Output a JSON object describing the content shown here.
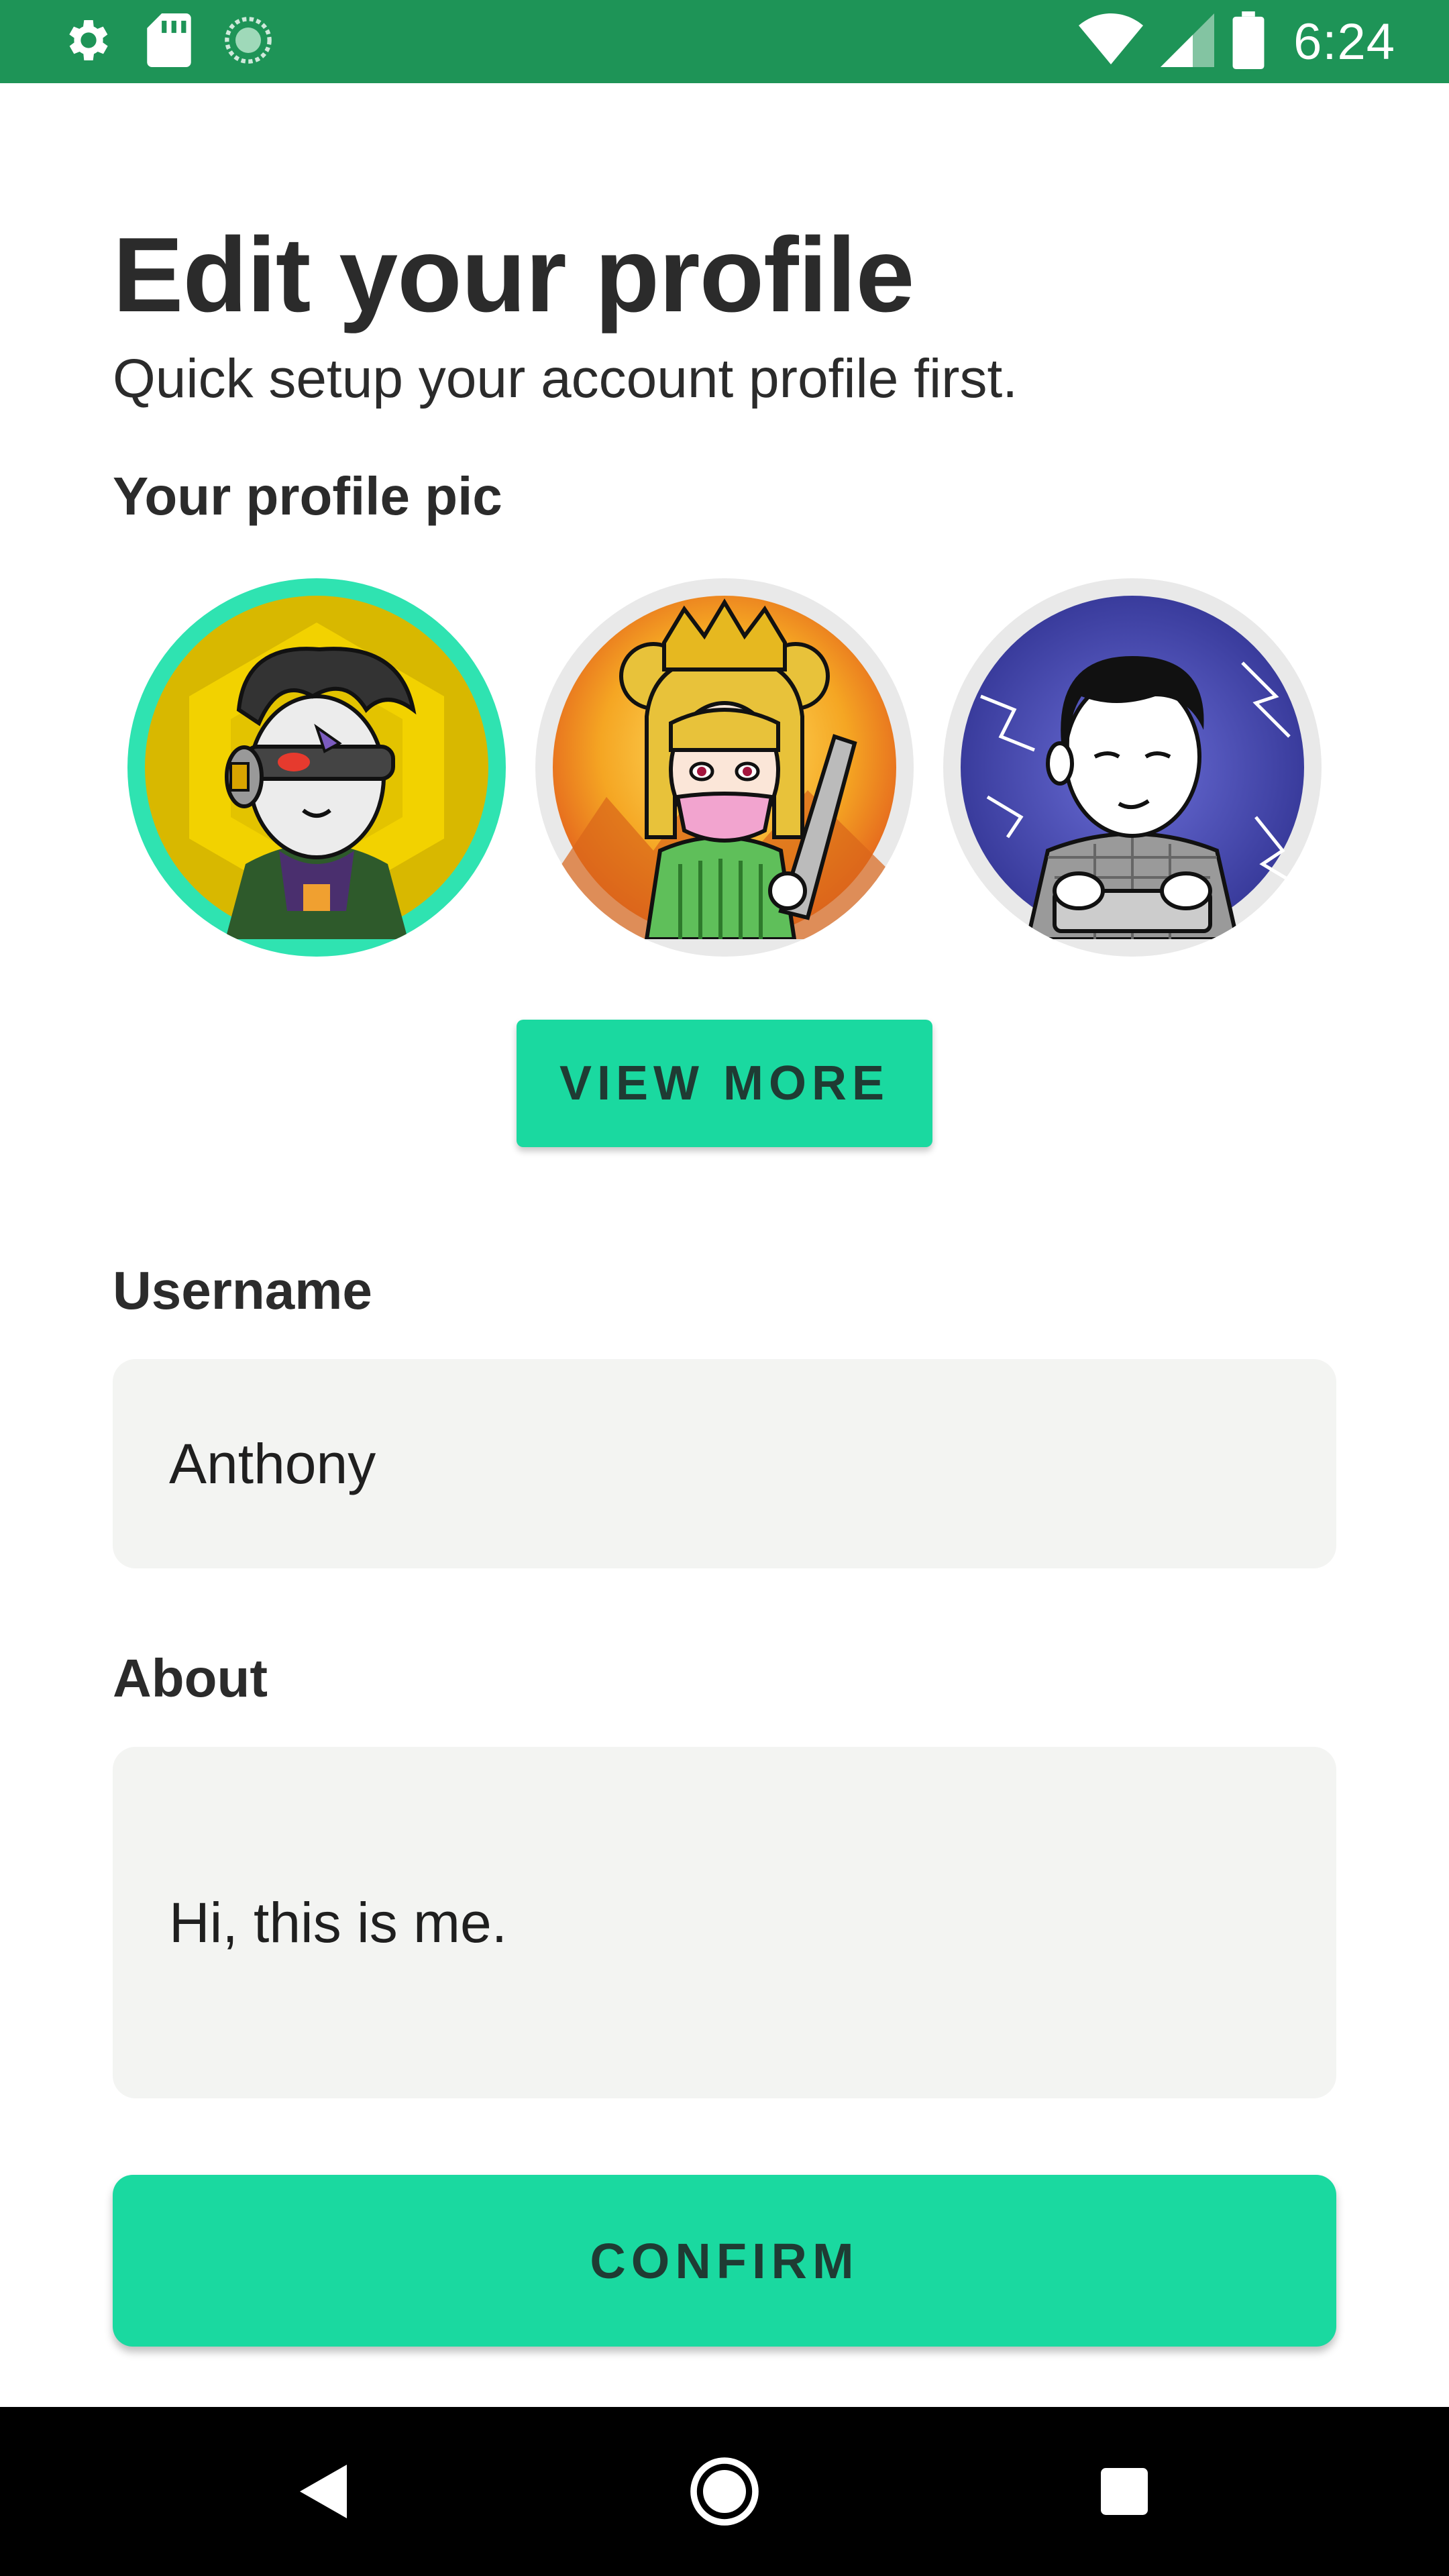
{
  "status_bar": {
    "time": "6:24",
    "left_icons": [
      "settings-icon",
      "sd-card-icon",
      "sync-icon"
    ],
    "right_icons": [
      "wifi-icon",
      "cell-signal-icon",
      "battery-icon"
    ]
  },
  "header": {
    "title": "Edit your profile",
    "subtitle": "Quick setup your account profile first."
  },
  "profile_pic": {
    "label": "Your profile pic",
    "avatars": [
      {
        "name": "cyborg-avatar",
        "selected": true
      },
      {
        "name": "crowned-girl-avatar",
        "selected": false
      },
      {
        "name": "office-man-avatar",
        "selected": false
      }
    ],
    "view_more_label": "VIEW MORE"
  },
  "username": {
    "label": "Username",
    "value": "Anthony"
  },
  "about": {
    "label": "About",
    "value": "Hi, this is me."
  },
  "confirm_label": "CONFIRM",
  "nav_bar": {
    "buttons": [
      "back-icon",
      "home-icon",
      "recents-icon"
    ]
  },
  "colors": {
    "status_bar": "#1e9457",
    "accent": "#1ad9a0",
    "selected_ring": "#2fe3b1",
    "field_background": "#f3f4f2",
    "text": "#2b2b2b"
  }
}
